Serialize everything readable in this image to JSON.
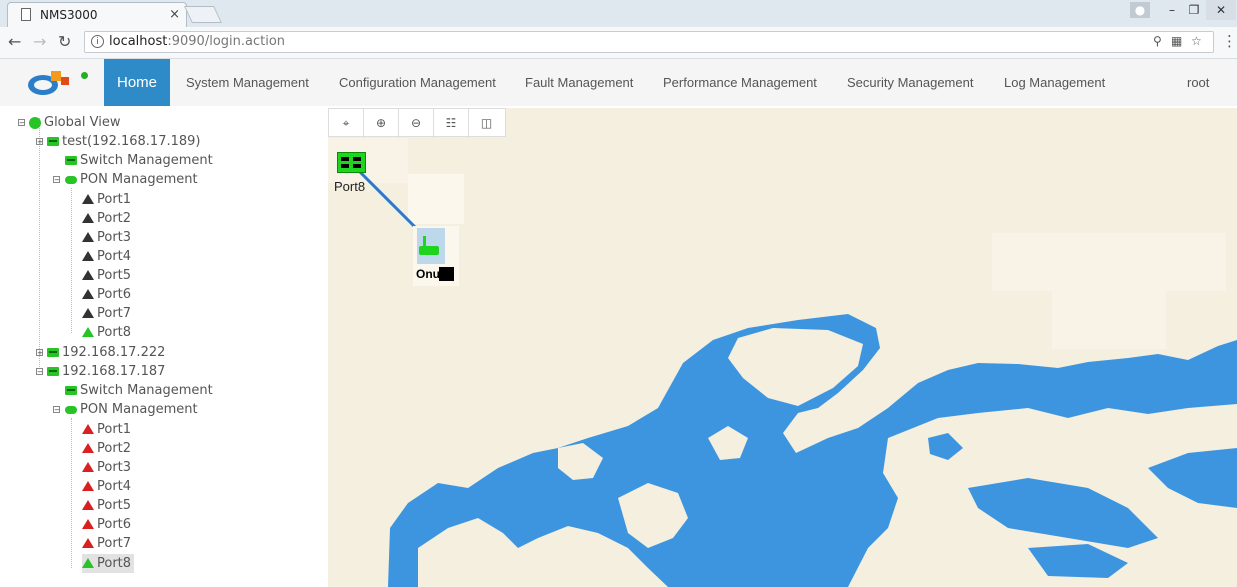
{
  "browser": {
    "tab_title": "NMS3000",
    "tab_close": "×",
    "url_host": "localhost",
    "url_rest": ":9090/login.action",
    "info_icon": "i",
    "colors": {
      "tabstrip": "#dfe7ef",
      "accent": "#2e8bc8"
    }
  },
  "nav": {
    "items": [
      {
        "label": "Home",
        "active": true
      },
      {
        "label": "System Management"
      },
      {
        "label": "Configuration Management"
      },
      {
        "label": "Fault Management"
      },
      {
        "label": "Performance Management"
      },
      {
        "label": "Security Management"
      },
      {
        "label": "Log Management"
      }
    ],
    "user": "root"
  },
  "tree": {
    "root": "Global View",
    "devices": [
      {
        "name": "test(192.168.17.189)",
        "switch": "Switch Management",
        "pon": "PON Management",
        "ports": [
          "Port1",
          "Port2",
          "Port3",
          "Port4",
          "Port5",
          "Port6",
          "Port7",
          "Port8"
        ],
        "port_status": [
          "offline",
          "offline",
          "offline",
          "offline",
          "offline",
          "offline",
          "offline",
          "online"
        ]
      },
      {
        "name": "192.168.17.222"
      },
      {
        "name": "192.168.17.187",
        "switch": "Switch Management",
        "pon": "PON Management",
        "ports": [
          "Port1",
          "Port2",
          "Port3",
          "Port4",
          "Port5",
          "Port6",
          "Port7",
          "Port8"
        ],
        "port_status": [
          "alarm",
          "alarm",
          "alarm",
          "alarm",
          "alarm",
          "alarm",
          "alarm",
          "online"
        ],
        "selected_port": "Port8"
      }
    ]
  },
  "map": {
    "tools": [
      "locate-icon",
      "zoom-in-icon",
      "zoom-out-icon",
      "topology-icon",
      "save-icon"
    ],
    "port_node_label": "Port8",
    "onu_label": "Onu",
    "colors": {
      "land": "#f4efdf",
      "water": "#3d95e0",
      "link": "#2a78d0"
    }
  }
}
